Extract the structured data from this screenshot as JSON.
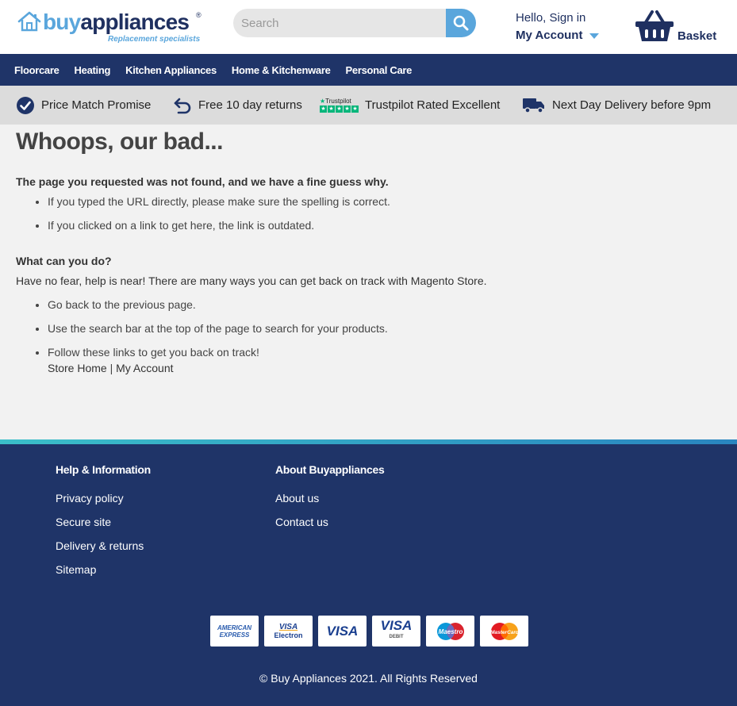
{
  "header": {
    "brand_part1": "buy",
    "brand_part2": "appliances",
    "brand_reg": "®",
    "tagline": "Replacement specialists",
    "search_placeholder": "Search",
    "search_value": "",
    "account_greeting": "Hello, Sign in",
    "account_label": "My Account",
    "basket_label": "Basket"
  },
  "nav": {
    "items": [
      "Floorcare",
      "Heating",
      "Kitchen Appliances",
      "Home & Kitchenware",
      "Personal Care"
    ]
  },
  "usp": {
    "price_match": "Price Match Promise",
    "returns": "Free 10 day returns",
    "trustpilot_logo": "Trustpilot",
    "trustpilot": "Trustpilot Rated Excellent",
    "delivery": "Next Day Delivery before 9pm"
  },
  "main": {
    "title": "Whoops, our bad...",
    "intro": "The page you requested was not found, and we have a fine guess why.",
    "reasons": [
      "If you typed the URL directly, please make sure the spelling is correct.",
      "If you clicked on a link to get here, the link is outdated."
    ],
    "what_heading": "What can you do?",
    "help_text": "Have no fear, help is near! There are many ways you can get back on track with Magento Store.",
    "actions": {
      "back": "Go back to the previous page.",
      "search": "Use the search bar at the top of the page to search for your products.",
      "follow": "Follow these links to get you back on track!",
      "store_home": "Store Home",
      "separator": "|",
      "my_account": "My Account"
    }
  },
  "footer": {
    "help_heading": "Help & Information",
    "help_links": [
      "Privacy policy",
      "Secure site",
      "Delivery & returns",
      "Sitemap"
    ],
    "about_heading": "About Buyappliances",
    "about_links": [
      "About us",
      "Contact us"
    ],
    "cards": {
      "amex_line1": "AMERICAN",
      "amex_line2": "EXPRESS",
      "electron_top": "VISA",
      "electron_bottom": "Electron",
      "visa": "VISA",
      "debit_top": "VISA",
      "debit_bottom": "DEBIT",
      "maestro": "Maestro",
      "mastercard": "MasterCard"
    },
    "copyright": "© Buy Appliances 2021. All Rights Reserved"
  },
  "colors": {
    "navy": "#1f3468",
    "light_blue": "#5aa6dc",
    "trustpilot_green": "#00b67a",
    "page_bg": "#f2f2f2",
    "usp_bg": "#dcdcdc"
  },
  "icons": {
    "logo": "house-icon",
    "search": "search-icon",
    "account_dropdown": "caret-down-icon",
    "basket": "basket-icon",
    "price_match": "check-circle-icon",
    "returns": "return-arrow-icon",
    "trustpilot": "trustpilot-stars-icon",
    "delivery": "truck-icon"
  }
}
